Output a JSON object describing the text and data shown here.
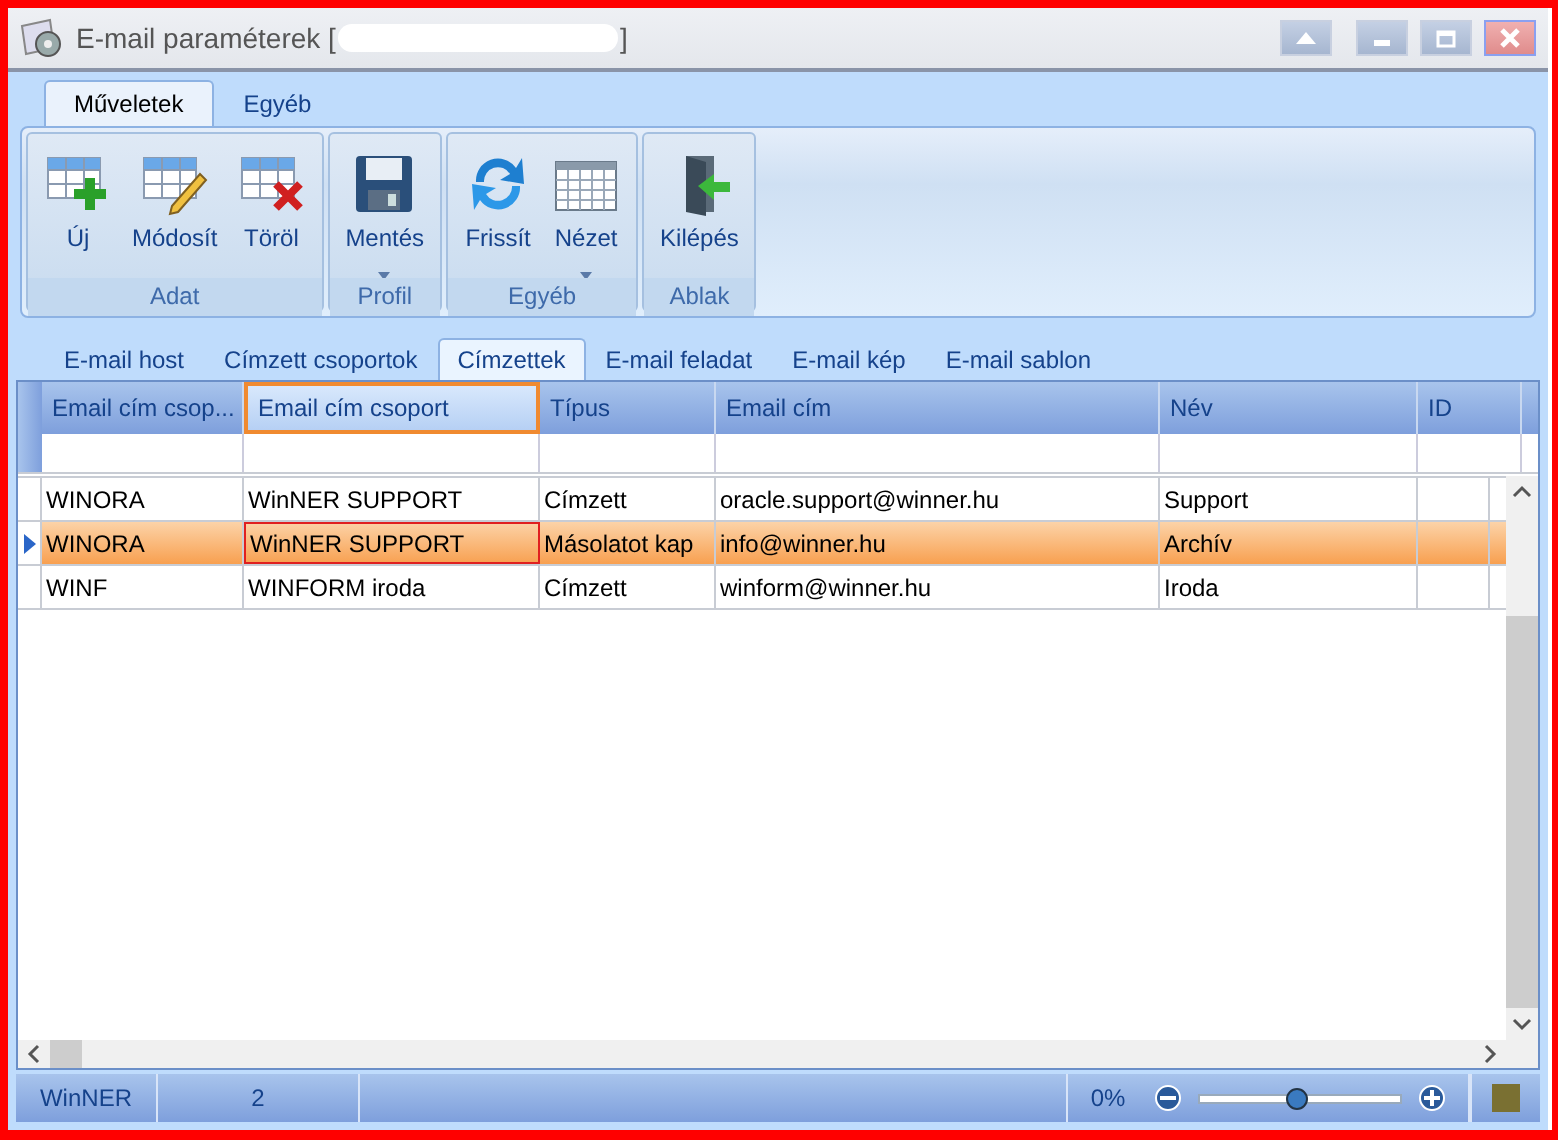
{
  "window": {
    "title": "E-mail paraméterek [",
    "title_end": "]"
  },
  "ribbon": {
    "tabs": [
      {
        "label": "Műveletek",
        "selected": true
      },
      {
        "label": "Egyéb",
        "selected": false
      }
    ],
    "groups": [
      {
        "label": "Adat",
        "buttons": [
          {
            "label": "Új",
            "kind": "grid-add",
            "dropdown": false
          },
          {
            "label": "Módosít",
            "kind": "grid-edit",
            "dropdown": false
          },
          {
            "label": "Töröl",
            "kind": "grid-delete",
            "dropdown": false
          }
        ]
      },
      {
        "label": "Profil",
        "buttons": [
          {
            "label": "Mentés",
            "kind": "save",
            "dropdown": true
          }
        ]
      },
      {
        "label": "Egyéb",
        "buttons": [
          {
            "label": "Frissít",
            "kind": "refresh",
            "dropdown": false
          },
          {
            "label": "Nézet",
            "kind": "table",
            "dropdown": true
          }
        ]
      },
      {
        "label": "Ablak",
        "buttons": [
          {
            "label": "Kilépés",
            "kind": "exit",
            "dropdown": false
          }
        ]
      }
    ]
  },
  "tabs": [
    {
      "label": "E-mail host",
      "selected": false
    },
    {
      "label": "Címzett csoportok",
      "selected": false
    },
    {
      "label": "Címzettek",
      "selected": true
    },
    {
      "label": "E-mail feladat",
      "selected": false
    },
    {
      "label": "E-mail kép",
      "selected": false
    },
    {
      "label": "E-mail sablon",
      "selected": false
    }
  ],
  "table": {
    "columns": [
      {
        "label": "Email cím csop...",
        "selected": false
      },
      {
        "label": "Email cím csoport",
        "selected": true
      },
      {
        "label": "Típus",
        "selected": false
      },
      {
        "label": "Email cím",
        "selected": false
      },
      {
        "label": "Név",
        "selected": false
      },
      {
        "label": "ID",
        "selected": false
      }
    ],
    "rows": [
      {
        "cells": [
          "WINORA",
          "WinNER SUPPORT",
          "Címzett",
          "oracle.support@winner.hu",
          "Support"
        ],
        "selected": false
      },
      {
        "cells": [
          "WINORA",
          "WinNER SUPPORT",
          "Másolatot kap",
          "info@winner.hu",
          "Archív"
        ],
        "selected": true
      },
      {
        "cells": [
          "WINF",
          "WINFORM iroda",
          "Címzett",
          "winform@winner.hu",
          "Iroda"
        ],
        "selected": false
      }
    ]
  },
  "status_bar": {
    "user": "WinNER",
    "count": "2",
    "zoom": "0%",
    "level": 0.48
  }
}
